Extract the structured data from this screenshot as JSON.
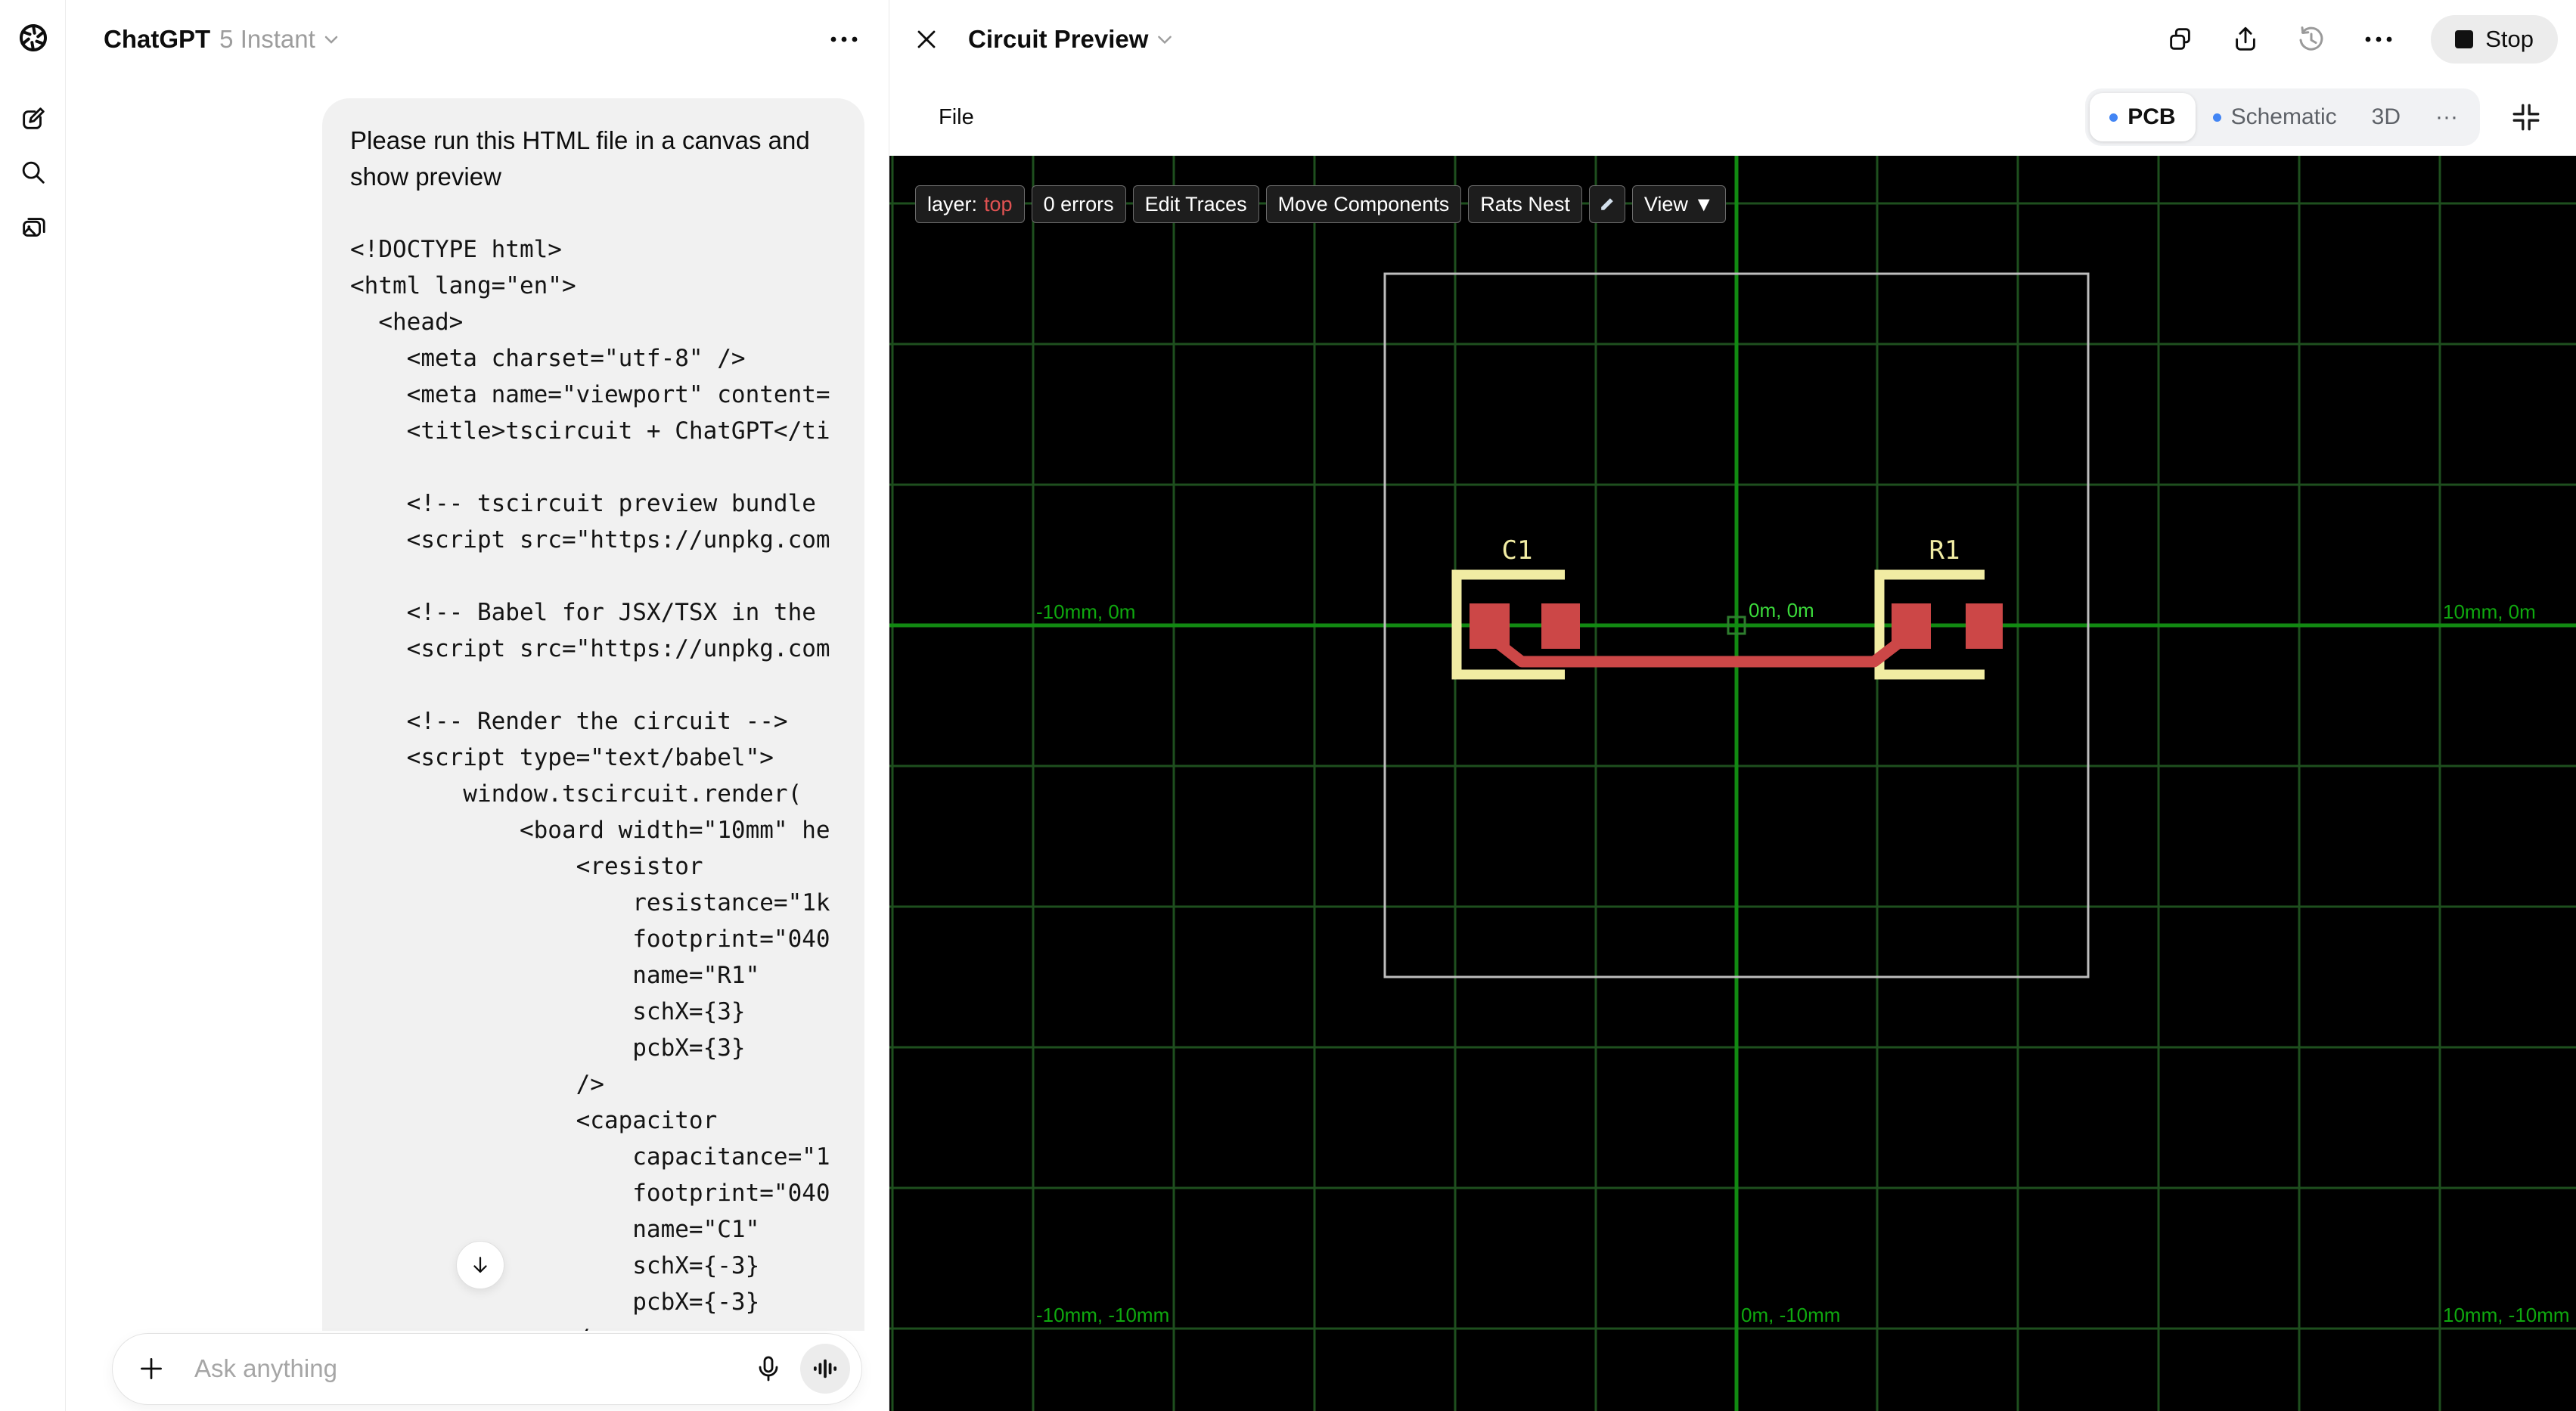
{
  "sidebar": {
    "icons": [
      "chatgpt-logo",
      "new-chat",
      "search",
      "library"
    ]
  },
  "chat": {
    "title": "ChatGPT",
    "model": "5 Instant",
    "menu_icon": "ellipsis",
    "message_text": "Please run this HTML file in a canvas and show preview",
    "code": "<!DOCTYPE html>\n<html lang=\"en\">\n  <head>\n    <meta charset=\"utf-8\" />\n    <meta name=\"viewport\" content=\n    <title>tscircuit + ChatGPT</ti\n\n    <!-- tscircuit preview bundle\n    <script src=\"https://unpkg.com\n\n    <!-- Babel for JSX/TSX in the\n    <script src=\"https://unpkg.com\n\n    <!-- Render the circuit -->\n    <script type=\"text/babel\">\n        window.tscircuit.render(\n            <board width=\"10mm\" he\n                <resistor\n                    resistance=\"1k\n                    footprint=\"040\n                    name=\"R1\"\n                    schX={3}\n                    pcbX={3}\n                />\n                <capacitor\n                    capacitance=\"1\n                    footprint=\"040\n                    name=\"C1\"\n                    schX={-3}\n                    pcbX={-3}\n                />",
    "composer_placeholder": "Ask anything"
  },
  "preview": {
    "title": "Circuit Preview",
    "stop_label": "Stop",
    "file_menu": "File",
    "tab_dot_color": "#4285f4",
    "tabs": {
      "pcb": "PCB",
      "schematic": "Schematic",
      "three_d": "3D",
      "more": "···"
    },
    "toolbar": {
      "layer_label": "layer:",
      "layer_value": "top",
      "layer_value_color": "#e05252",
      "errors": "0 errors",
      "edit_traces": "Edit Traces",
      "move_components": "Move Components",
      "rats_nest": "Rats Nest",
      "view": "View ▼"
    }
  },
  "pcb": {
    "board": {
      "width_mm": 10,
      "height_mm": 10,
      "grid_spacing_mm": 2
    },
    "components": [
      {
        "ref": "C1",
        "type": "capacitor",
        "pcb_x_mm": -3,
        "pads_x_mm": [
          -3.5,
          -2.5
        ]
      },
      {
        "ref": "R1",
        "type": "resistor",
        "pcb_x_mm": 3,
        "pads_x_mm": [
          2.5,
          3.5
        ]
      }
    ],
    "origin_label": "0m, 0m",
    "coord_labels": [
      {
        "text": "-10mm, 0m"
      },
      {
        "text": "0m, 0m"
      },
      {
        "text": "10mm, 0m"
      },
      {
        "text": "-10mm, -10mm"
      },
      {
        "text": "0m, -10mm"
      },
      {
        "text": "10mm, -10mm"
      }
    ],
    "colors": {
      "copper": "#cc4747",
      "silkscreen": "#f1eca3",
      "grid": "#1e4f1e",
      "axis": "#128a12",
      "label": "#0fa80f",
      "origin_label": "#3bdb3b",
      "board_outline": "#bdbdbd"
    }
  }
}
